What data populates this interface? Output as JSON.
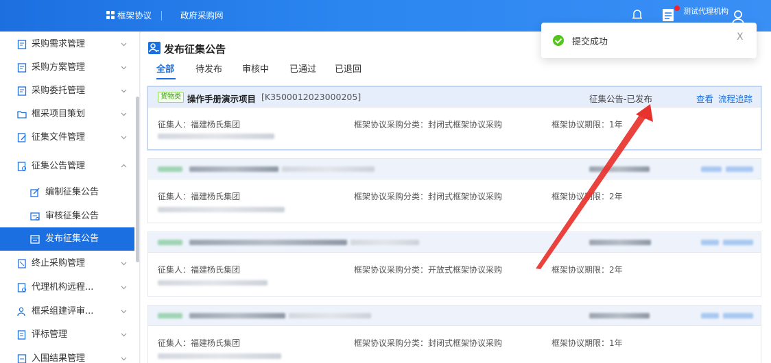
{
  "topbar": {
    "nav_framework": "框架协议",
    "nav_gov": "政府采购网",
    "org_name": "测试代理机构"
  },
  "sidebar": {
    "items": [
      {
        "label": "采购需求管理"
      },
      {
        "label": "采购方案管理"
      },
      {
        "label": "采购委托管理"
      },
      {
        "label": "框采项目策划"
      },
      {
        "label": "征集文件管理"
      },
      {
        "label": "征集公告管理"
      },
      {
        "label": "编制征集公告"
      },
      {
        "label": "审核征集公告"
      },
      {
        "label": "发布征集公告"
      },
      {
        "label": "终止采购管理"
      },
      {
        "label": "代理机构远程..."
      },
      {
        "label": "框采组建评审..."
      },
      {
        "label": "评标管理"
      },
      {
        "label": "入围结果管理"
      }
    ]
  },
  "page": {
    "title": "发布征集公告",
    "tabs": [
      "全部",
      "待发布",
      "审核中",
      "已通过",
      "已退回"
    ]
  },
  "cards": [
    {
      "badge": "货物类",
      "name": "操作手册演示项目",
      "code": "[K3500012023000205]",
      "status": "征集公告-已发布",
      "action_view": "查看",
      "action_trace": "流程追踪",
      "collector": "征集人：福建杨氏集团",
      "category": "框架协议采购分类：封闭式框架协议采购",
      "period": "框架协议期限：1年"
    },
    {
      "collector": "征集人：福建杨氏集团",
      "category": "框架协议采购分类：封闭式框架协议采购",
      "period": "框架协议期限：2年"
    },
    {
      "collector": "征集人：福建杨氏集团",
      "category": "框架协议采购分类：开放式框架协议采购",
      "period": "框架协议期限：2年"
    },
    {
      "collector": "征集人：福建杨氏集团",
      "category": "框架协议采购分类：封闭式框架协议采购",
      "period": "框架协议期限：1年"
    }
  ],
  "toast": {
    "message": "提交成功",
    "close": "X"
  },
  "colors": {
    "primary": "#1c6fe0",
    "success": "#52c41a",
    "arrow": "#e8322d"
  }
}
